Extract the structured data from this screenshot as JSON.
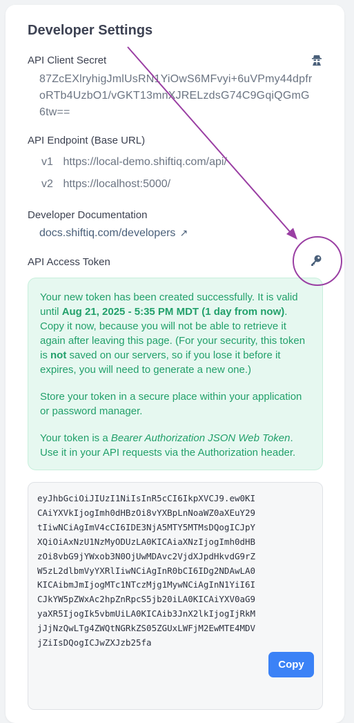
{
  "page": {
    "title": "Developer Settings"
  },
  "client_secret": {
    "label": "API Client Secret",
    "value": "87ZcEXlryhigJmlUsRN1YiOwS6MFvyi+6uVPmy44dpfroRTb4UzbO1/vGKT13mnXJRELzdsG74C9GqiQGmG6tw==",
    "icon": "secret-agent-icon"
  },
  "endpoint": {
    "label": "API Endpoint (Base URL)",
    "items": [
      {
        "version": "v1",
        "url": "https://local-demo.shiftiq.com/api/"
      },
      {
        "version": "v2",
        "url": "https://localhost:5000/"
      }
    ]
  },
  "docs": {
    "label": "Developer Documentation",
    "link": "docs.shiftiq.com/developers",
    "link_icon": "↗"
  },
  "token": {
    "label": "API Access Token",
    "icon": "key-icon",
    "msg1_a": "Your new token has been created successfully. It is valid until ",
    "msg1_b": "Aug 21, 2025 - 5:35 PM MDT (1 day from now)",
    "msg1_c": ". Copy it now, because you will not be able to retrieve it again after leaving this page. (For your security, this token is ",
    "msg1_d": "not",
    "msg1_e": " saved on our servers, so if you lose it before it expires, you will need to generate a new one.)",
    "msg2": "Store your token in a secure place within your application or password manager.",
    "msg3_a": "Your token is a ",
    "msg3_b": "Bearer Authorization JSON Web Token",
    "msg3_c": ". Use it in your API requests via the Authorization header.",
    "value": "eyJhbGciOiJIUzI1NiIsInR5cCI6IkpXVCJ9.ew0KICAiYXVkIjogImh0dHBzOi8vYXBpLnNoaWZ0aXEuY29tIiwNCiAgImV4cCI6IDE3NjA5MTY5MTMsDQogICJpYXQiOiAxNzU1NzMyODUzLA0KICAiaXNzIjogImh0dHBzOi8vbG9jYWxob3N0OjUwMDAvc2VjdXJpdHkvdG9rZW5zL2dlbmVyYXRlIiwNCiAgInR0bCI6IDg2NDAwLA0KICAibmJmIjogMTc1NTczMjg1MywNCiAgInN1YiI6ICJkYW5pZWxAc2hpZnRpcS5jb20iLA0KICAiYXV0aG9yaXR5IjogIk5vbmUiLA0KICAib3JnX2lkIjogIjRkMjJjNzQwLTg4ZWQtNGRkZS05ZGUxLWFjM2EwMTE4MDVjZiIsDQogICJwZXJzb25fa",
    "copy_label": "Copy"
  },
  "colors": {
    "success_bg": "#e6f8f0",
    "success_text": "#22a06b",
    "copy_button": "#3b82f6",
    "annotation": "#9a3fa3"
  }
}
